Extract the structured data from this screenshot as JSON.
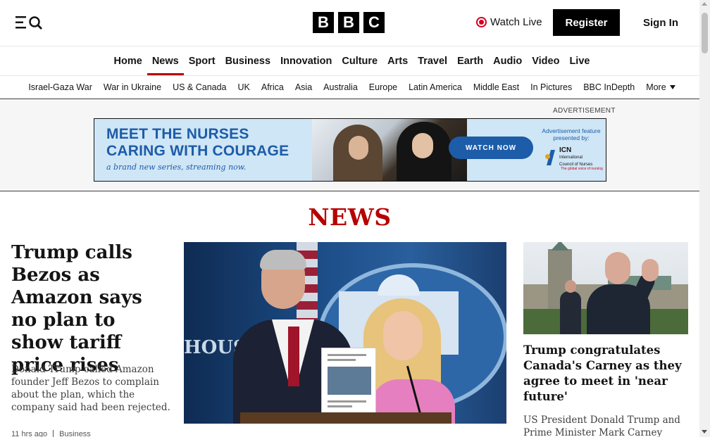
{
  "header": {
    "logo_letters": [
      "B",
      "B",
      "C"
    ],
    "watch_live_label": "Watch Live",
    "register_label": "Register",
    "sign_in_label": "Sign In",
    "icons": [
      "menu-icon",
      "search-icon",
      "live-dot-icon"
    ],
    "live_color": "#d6001c"
  },
  "primary_nav": {
    "items": [
      {
        "label": "Home"
      },
      {
        "label": "News",
        "active": true
      },
      {
        "label": "Sport"
      },
      {
        "label": "Business"
      },
      {
        "label": "Innovation"
      },
      {
        "label": "Culture"
      },
      {
        "label": "Arts"
      },
      {
        "label": "Travel"
      },
      {
        "label": "Earth"
      },
      {
        "label": "Audio"
      },
      {
        "label": "Video"
      },
      {
        "label": "Live"
      }
    ],
    "active_color": "#b80000"
  },
  "secondary_nav": {
    "items": [
      {
        "label": "Israel-Gaza War"
      },
      {
        "label": "War in Ukraine"
      },
      {
        "label": "US & Canada"
      },
      {
        "label": "UK"
      },
      {
        "label": "Africa"
      },
      {
        "label": "Asia"
      },
      {
        "label": "Australia"
      },
      {
        "label": "Europe"
      },
      {
        "label": "Latin America"
      },
      {
        "label": "Middle East"
      },
      {
        "label": "In Pictures"
      },
      {
        "label": "BBC InDepth"
      }
    ],
    "more_label": "More"
  },
  "ad": {
    "label": "ADVERTISEMENT",
    "headline_line1": "MEET THE NURSES",
    "headline_line2": "CARING WITH COURAGE",
    "subline": "a brand new series, streaming now.",
    "cta_label": "WATCH NOW",
    "feature_text": "Advertisement feature presented by:",
    "sponsor_short": "ICN",
    "sponsor_name_line1": "International",
    "sponsor_name_line2": "Council of Nurses",
    "sponsor_tagline": "The global voice of nursing",
    "brand_color": "#1d5ca8"
  },
  "section": {
    "title": "NEWS",
    "color": "#b80000"
  },
  "lead_story": {
    "headline": "Trump calls Bezos as Amazon says no plan to show tariff price rises",
    "summary": "Donald Trump called Amazon founder Jeff Bezos to complain about the plan, which the company said had been rejected.",
    "time": "11 hrs ago",
    "category": "Business"
  },
  "side_story": {
    "headline": "Trump congratulates Canada's Carney as they agree to meet in 'near future'",
    "summary": "US President Donald Trump and Prime Minister Mark Carney"
  },
  "hero_image": {
    "sign_text": "HOUSE"
  }
}
